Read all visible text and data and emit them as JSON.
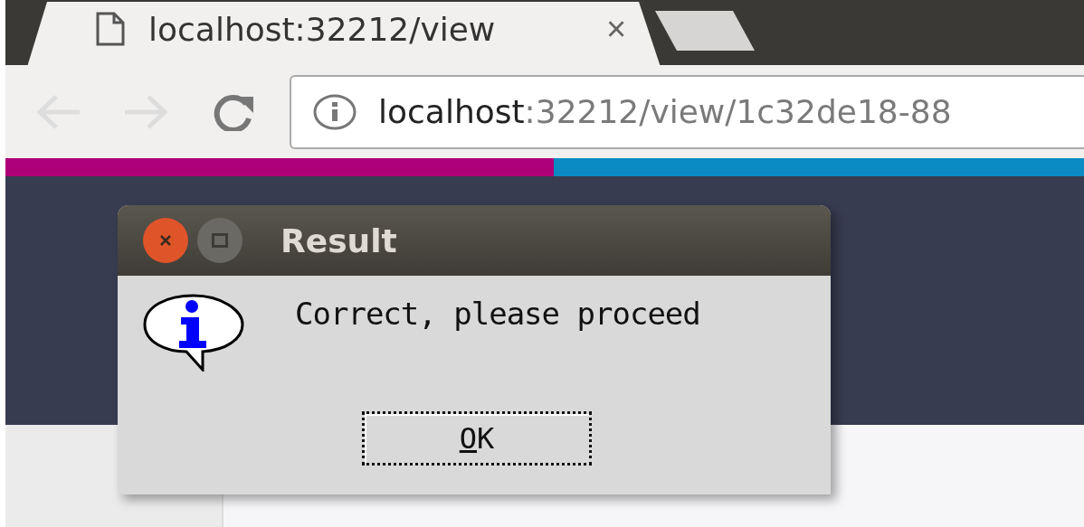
{
  "browser": {
    "tab": {
      "title": "localhost:32212/view",
      "close": "×"
    },
    "address": {
      "host": "localhost",
      "path": ":32212/view/1c32de18-88"
    }
  },
  "dialog": {
    "title": "Result",
    "message": "Correct, please proceed",
    "buttons": [
      {
        "label": "OK",
        "focused": true
      }
    ]
  }
}
